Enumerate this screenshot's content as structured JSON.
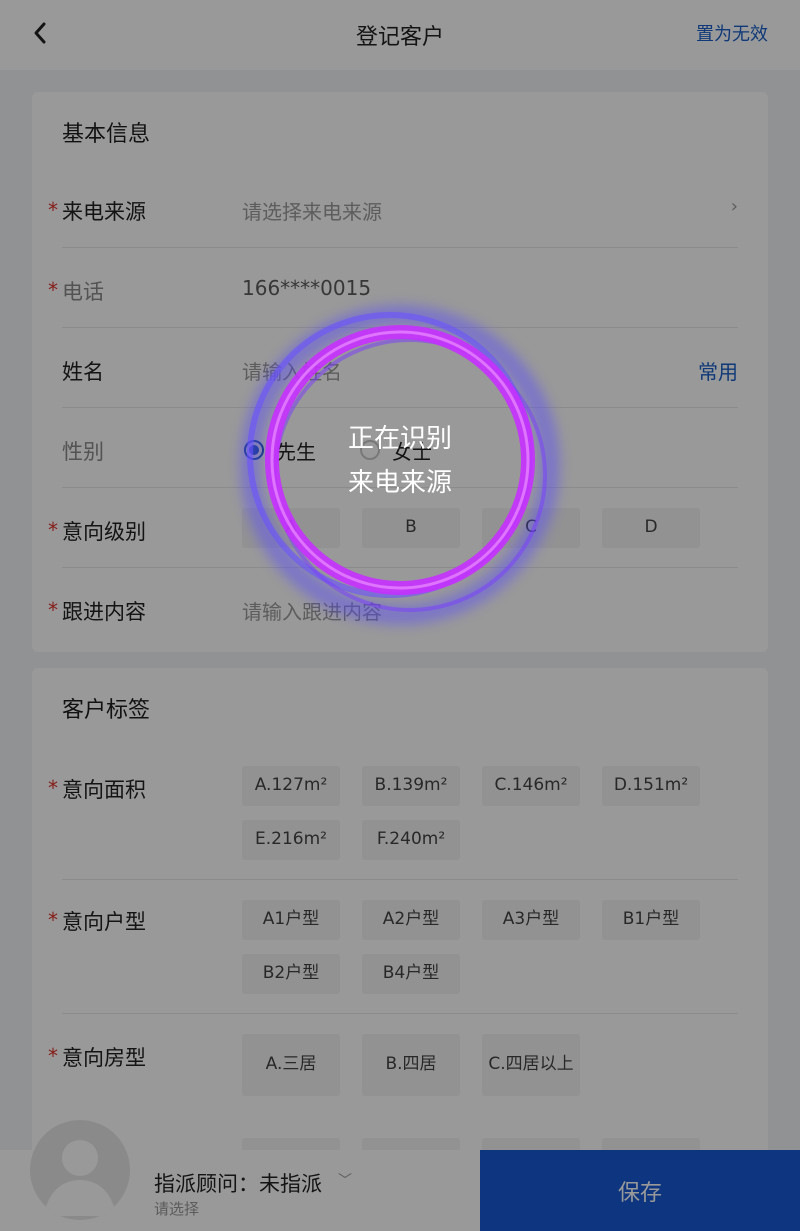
{
  "header": {
    "title": "登记客户",
    "invalid_label": "置为无效"
  },
  "basic_info": {
    "section_title": "基本信息",
    "source": {
      "label": "来电来源",
      "placeholder": "请选择来电来源"
    },
    "phone": {
      "label": "电话",
      "value": "166****0015"
    },
    "name": {
      "label": "姓名",
      "placeholder": "请输入姓名",
      "common_label": "常用"
    },
    "gender": {
      "label": "性别",
      "options": [
        "先生",
        "女士"
      ],
      "selected": "先生"
    },
    "intent_level": {
      "label": "意向级别",
      "options": [
        "A",
        "B",
        "C",
        "D"
      ]
    },
    "followup": {
      "label": "跟进内容",
      "placeholder": "请输入跟进内容"
    },
    "required_mark": "*"
  },
  "customer_tags": {
    "section_title": "客户标签",
    "area": {
      "label": "意向面积",
      "options": [
        "A.127m²",
        "B.139m²",
        "C.146m²",
        "D.151m²",
        "E.216m²",
        "F.240m²"
      ]
    },
    "unit_type": {
      "label": "意向户型",
      "options": [
        "A1户型",
        "A2户型",
        "A3户型",
        "B1户型",
        "B2户型",
        "B4户型"
      ]
    },
    "room_type": {
      "label": "意向房型",
      "options": [
        "A.三居",
        "B.四居",
        "C.四居以上"
      ]
    }
  },
  "bottom_bar": {
    "assign_label": "指派顾问：未指派",
    "assign_sub": "请选择",
    "save_label": "保存"
  },
  "overlay": {
    "line1": "正在识别",
    "line2": "来电来源"
  },
  "colors": {
    "accent": "#1659d6",
    "link": "#1a5fc8",
    "required": "#e0322b",
    "ring": "#b02cf0"
  }
}
